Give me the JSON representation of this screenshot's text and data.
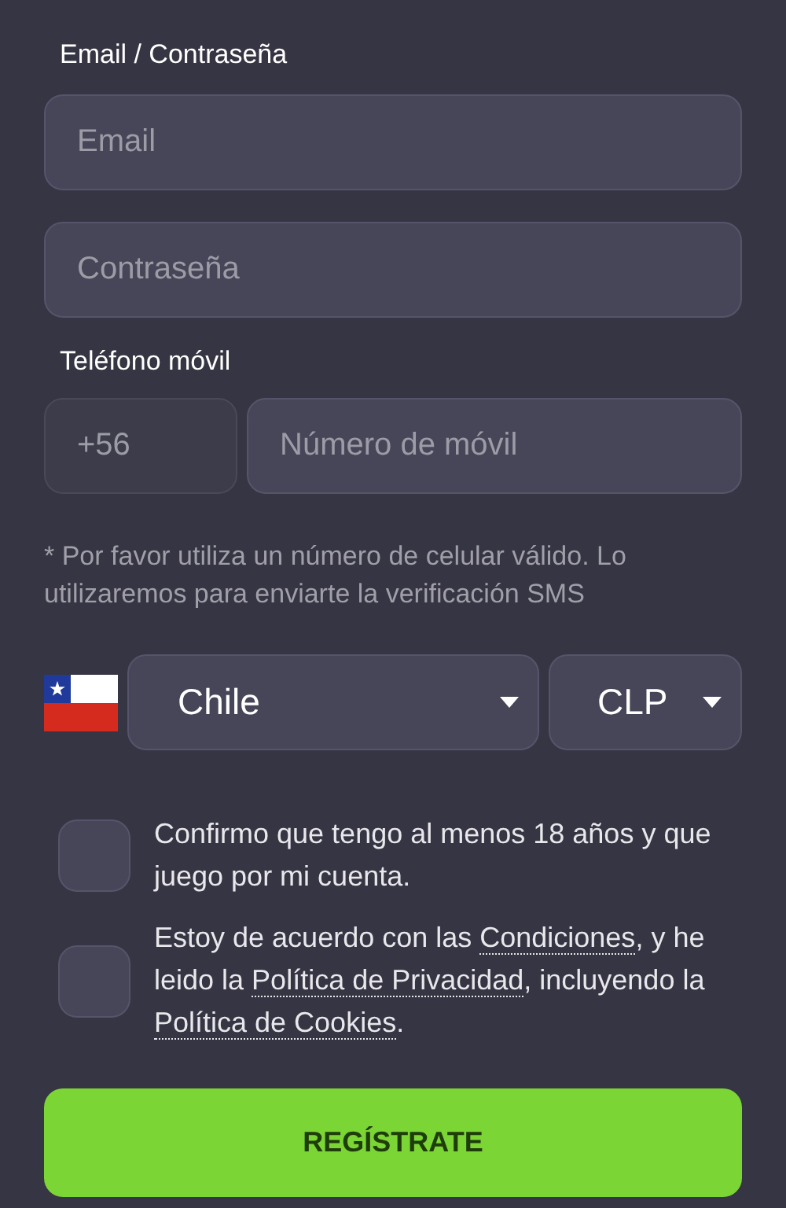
{
  "credentials_label": "Email / Contraseña",
  "email_field": {
    "placeholder": "Email"
  },
  "password_field": {
    "placeholder": "Contraseña"
  },
  "phone_label": "Teléfono móvil",
  "phone_code": {
    "value": "+56"
  },
  "phone_field": {
    "placeholder": "Número de móvil"
  },
  "phone_note": "* Por favor utiliza un número de celular válido. Lo utilizaremos para enviarte la verificación SMS",
  "country_select": {
    "value": "Chile"
  },
  "currency_select": {
    "value": "CLP"
  },
  "checkboxes": [
    {
      "checked": false,
      "parts": [
        {
          "kind": "text",
          "text": "Confirmo que tengo al menos 18 años y que juego por mi cuenta."
        }
      ]
    },
    {
      "checked": false,
      "parts": [
        {
          "kind": "text",
          "text": "Estoy de acuerdo con las "
        },
        {
          "kind": "link",
          "text": "Condiciones"
        },
        {
          "kind": "text",
          "text": ", y he leido la "
        },
        {
          "kind": "link",
          "text": "Política de Privacidad"
        },
        {
          "kind": "text",
          "text": ", incluyendo la "
        },
        {
          "kind": "link",
          "text": "Política de Cookies"
        },
        {
          "kind": "text",
          "text": "."
        }
      ]
    }
  ],
  "submit_button": "REGÍSTRATE"
}
